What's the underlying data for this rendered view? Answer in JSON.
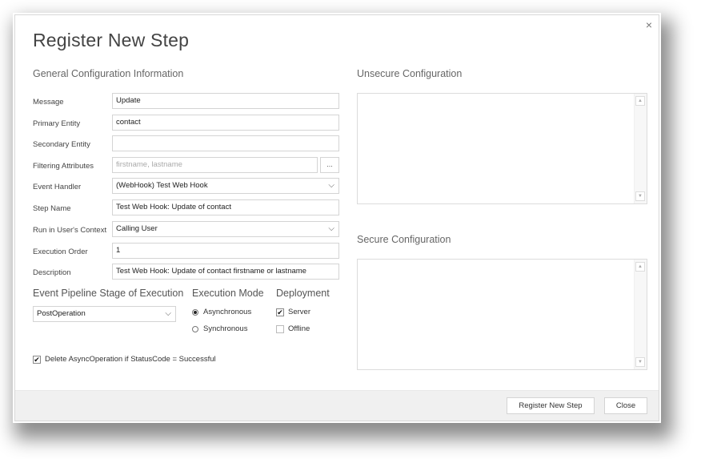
{
  "dialog": {
    "title": "Register New Step",
    "close_icon": "close-icon"
  },
  "general": {
    "heading": "General Configuration Information",
    "fields": {
      "message": {
        "label": "Message",
        "value": "Update"
      },
      "primary_entity": {
        "label": "Primary Entity",
        "value": "contact"
      },
      "secondary_entity": {
        "label": "Secondary Entity",
        "value": ""
      },
      "filtering_attributes": {
        "label": "Filtering Attributes",
        "value": "",
        "placeholder": "firstname, lastname",
        "browse_label": "..."
      },
      "event_handler": {
        "label": "Event Handler",
        "value": "(WebHook) Test Web Hook"
      },
      "step_name": {
        "label": "Step Name",
        "value": "Test Web Hook: Update of contact"
      },
      "run_context": {
        "label": "Run in User's Context",
        "value": "Calling User"
      },
      "execution_order": {
        "label": "Execution Order",
        "value": "1"
      },
      "description": {
        "label": "Description",
        "value": "Test Web Hook: Update of contact firstname or lastname"
      }
    }
  },
  "pipeline": {
    "heading": "Event Pipeline Stage of Execution",
    "value": "PostOperation"
  },
  "execution_mode": {
    "heading": "Execution Mode",
    "options": [
      {
        "label": "Asynchronous",
        "selected": true
      },
      {
        "label": "Synchronous",
        "selected": false
      }
    ]
  },
  "deployment": {
    "heading": "Deployment",
    "options": [
      {
        "label": "Server",
        "checked": true
      },
      {
        "label": "Offline",
        "checked": false
      }
    ]
  },
  "delete_async": {
    "label": "Delete AsyncOperation if StatusCode = Successful",
    "checked": true
  },
  "unsecure": {
    "heading": "Unsecure  Configuration",
    "value": ""
  },
  "secure": {
    "heading": "Secure  Configuration",
    "value": ""
  },
  "footer": {
    "register_label": "Register New Step",
    "close_label": "Close"
  },
  "glyphs": {
    "close": "×",
    "chevron": "⌵",
    "check": "✔",
    "up": "▲",
    "down": "▼"
  }
}
